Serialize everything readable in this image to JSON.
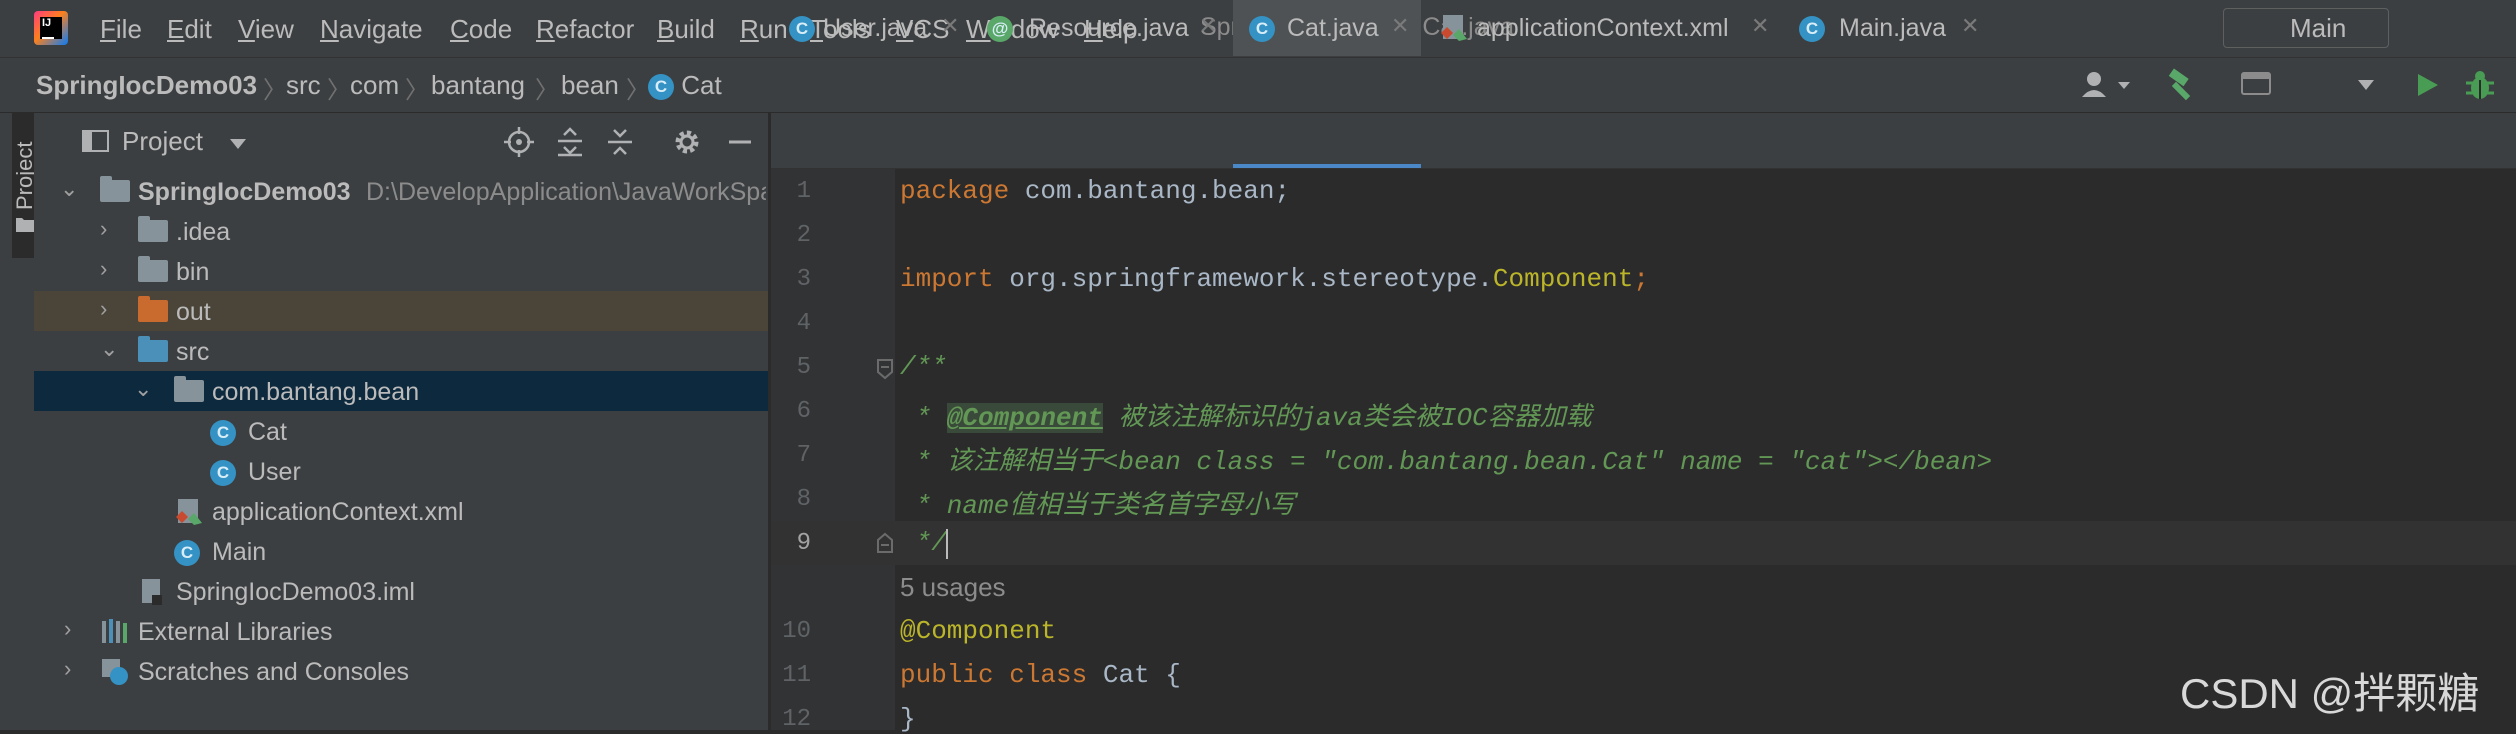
{
  "menu": {
    "items": [
      {
        "mnemonic": "F",
        "rest": "ile"
      },
      {
        "mnemonic": "E",
        "rest": "dit"
      },
      {
        "mnemonic": "V",
        "rest": "iew"
      },
      {
        "mnemonic": "N",
        "rest": "avigate"
      },
      {
        "mnemonic": "C",
        "rest": "ode"
      },
      {
        "mnemonic": "R",
        "rest": "efactor"
      },
      {
        "mnemonic": "B",
        "rest": "uild"
      },
      {
        "mnemonic": "R",
        "rest": "un"
      },
      {
        "mnemonic": "T",
        "rest": "ools"
      },
      {
        "mnemonic": "V",
        "rest": "CS"
      },
      {
        "mnemonic": "W",
        "rest": "indow"
      },
      {
        "mnemonic": "H",
        "rest": "elp"
      }
    ],
    "window_title": "SpringIocDemo03 - Cat.java"
  },
  "breadcrumb": {
    "project": "SpringIocDemo03",
    "items": [
      "src",
      "com",
      "bantang",
      "bean"
    ],
    "file": "Cat"
  },
  "toolbar": {
    "run_config": "Main"
  },
  "project_panel": {
    "vertical_tab": "Project",
    "title": "Project",
    "tree": {
      "root_name": "SpringIocDemo03",
      "root_path": "D:\\DevelopApplication\\JavaWorkSpace",
      "idea": ".idea",
      "bin": "bin",
      "out": "out",
      "src": "src",
      "package": "com.bantang.bean",
      "cat": "Cat",
      "user": "User",
      "app_context": "applicationContext.xml",
      "main": "Main",
      "iml": "SpringIocDemo03.iml",
      "ext_libs": "External Libraries",
      "scratches": "Scratches and Consoles"
    }
  },
  "editor": {
    "tabs": [
      {
        "label": "User.java"
      },
      {
        "label": "Resource.java"
      },
      {
        "label": "Cat.java"
      },
      {
        "label": "applicationContext.xml"
      },
      {
        "label": "Main.java"
      }
    ],
    "active_tab": "Cat.java",
    "line_numbers": [
      "1",
      "2",
      "3",
      "4",
      "5",
      "6",
      "7",
      "8",
      "9",
      "10",
      "11",
      "12"
    ],
    "code": {
      "l1_kw": "package",
      "l1_rest": " com.bantang.bean;",
      "l3_kw": "import",
      "l3_mid": " org.springframework.stereotype.",
      "l3_ann": "Component",
      "l3_end": ";",
      "l5": "/**",
      "l6_pre": " * ",
      "l6_tag": "@Component",
      "l6_text": " 被该注解标识的java类会被IOC容器加载",
      "l7": " * 该注解相当于<bean class = \"com.bantang.bean.Cat\" name = \"cat\"></bean>",
      "l8": " * name值相当于类名首字母小写",
      "l9": " */",
      "usages": "5 usages",
      "l10": "@Component",
      "l11_kw": "public class",
      "l11_rest": " Cat {",
      "l12": "}"
    }
  },
  "watermark": "CSDN @拌颗糖",
  "colors": {
    "background": "#2b2b2b",
    "panel": "#3c3f41",
    "selection": "#0d293e",
    "keyword": "#cc7832",
    "annotation": "#bbb529",
    "comment": "#629755",
    "accent": "#4a88c7"
  },
  "icons": [
    "intellij-logo-icon",
    "class-icon",
    "user-icon",
    "build-hammer-icon",
    "run-icon",
    "debug-icon",
    "locate-icon",
    "expand-all-icon",
    "collapse-all-icon",
    "gear-icon",
    "minimize-icon",
    "folder-icon",
    "xml-icon",
    "library-icon",
    "scratches-icon",
    "close-icon"
  ]
}
